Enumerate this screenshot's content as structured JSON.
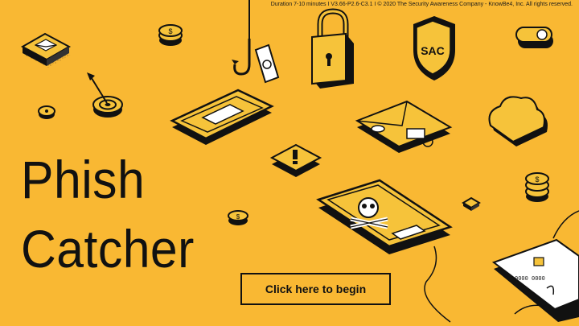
{
  "credits": {
    "text": "Duration 7-10 minutes  I  V3.66-P2.6-C3.1  I  © 2020 The Security Awareness Company - KnowBe4, Inc. All rights reserved."
  },
  "title": {
    "line1": "Phish",
    "line2": "Catcher"
  },
  "begin_button": {
    "label": "Click here to begin"
  },
  "illustration": {
    "badge_text": "SAC",
    "coin_symbol": "$",
    "icons": [
      "envelope-icon",
      "coin-stack-icon",
      "fishhook-icon",
      "dollar-bill-icon",
      "padlock-icon",
      "sac-shield-icon",
      "toggle-switch-icon",
      "target-icon",
      "tablet-icon",
      "mail-card-icon",
      "cloud-icon",
      "alert-box-icon",
      "smartphone-skull-icon",
      "credit-card-icon",
      "chip-icon"
    ]
  },
  "colors": {
    "background": "#F9B833",
    "ink": "#111111",
    "accent": "#F6C33A"
  }
}
